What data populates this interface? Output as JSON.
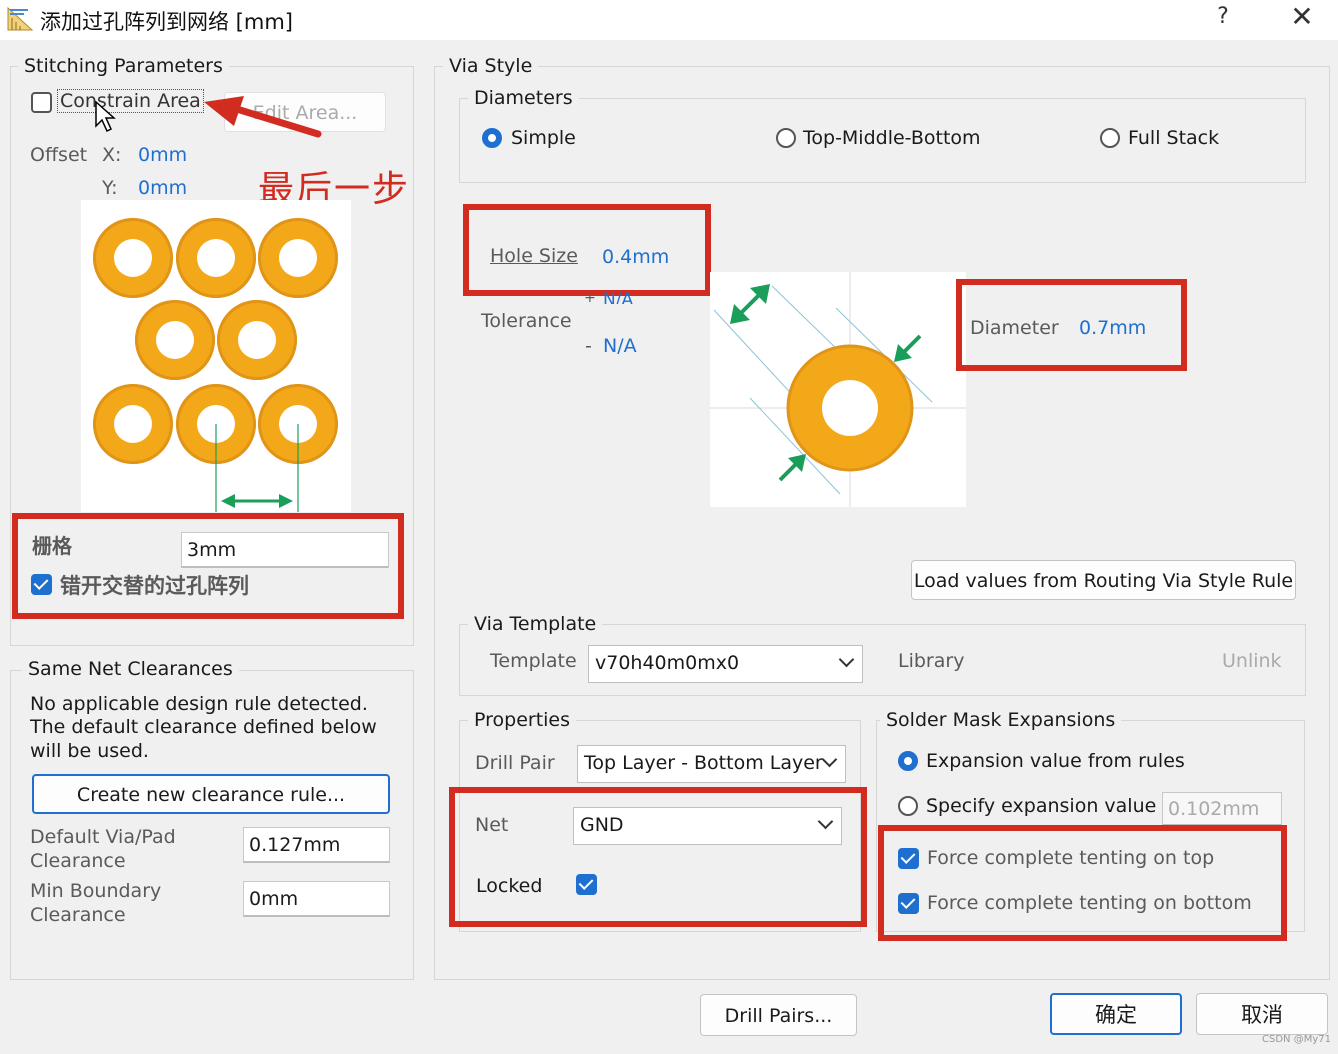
{
  "window": {
    "title": "添加过孔阵列到网络 [mm]",
    "help_label": "?",
    "close_label": "✕"
  },
  "stitching": {
    "legend": "Stitching Parameters",
    "constrain_area_label": "Constrain Area",
    "constrain_area_checked": false,
    "edit_area_label": "Edit Area...",
    "offset_label": "Offset",
    "x_label": "X:",
    "x_value": "0mm",
    "y_label": "Y:",
    "y_value": "0mm",
    "annotation": "最后一步",
    "grid_label": "栅格",
    "grid_value": "3mm",
    "stagger_label": "错开交替的过孔阵列",
    "stagger_checked": true
  },
  "clearances": {
    "legend": "Same Net Clearances",
    "message_line1": "No applicable design rule detected.",
    "message_line2": "The default clearance defined below",
    "message_line3": "will be used.",
    "create_rule_label": "Create new clearance rule...",
    "default_label_1": "Default Via/Pad",
    "default_label_2": "Clearance",
    "default_value": "0.127mm",
    "min_boundary_label_1": "Min Boundary",
    "min_boundary_label_2": "Clearance",
    "min_boundary_value": "0mm"
  },
  "via_style": {
    "legend": "Via Style",
    "diameters_legend": "Diameters",
    "radio_simple": "Simple",
    "radio_tmb": "Top-Middle-Bottom",
    "radio_full": "Full Stack",
    "selected": "Simple",
    "hole_size_label": "Hole Size",
    "hole_size_value": "0.4mm",
    "tolerance_label": "Tolerance",
    "tol_plus_sign": "+",
    "tol_plus_value": "N/A",
    "tol_minus_sign": "-",
    "tol_minus_value": "N/A",
    "diameter_label": "Diameter",
    "diameter_value": "0.7mm",
    "load_rule_label": "Load values from Routing Via Style Rule"
  },
  "via_template": {
    "legend": "Via Template",
    "template_label": "Template",
    "template_value": "v70h40m0mx0",
    "library_label": "Library",
    "unlink_label": "Unlink"
  },
  "properties": {
    "legend": "Properties",
    "drill_pair_label": "Drill Pair",
    "drill_pair_value": "Top Layer - Bottom Layer",
    "net_label": "Net",
    "net_value": "GND",
    "locked_label": "Locked",
    "locked_checked": true
  },
  "solder_mask": {
    "legend": "Solder Mask Expansions",
    "radio_rules": "Expansion value from rules",
    "radio_specify": "Specify expansion value",
    "specify_value": "0.102mm",
    "selected": "Expansion value from rules",
    "tent_top_label": "Force complete tenting on top",
    "tent_top_checked": true,
    "tent_bottom_label": "Force complete tenting on bottom",
    "tent_bottom_checked": true
  },
  "footer": {
    "drill_pairs_label": "Drill Pairs...",
    "ok_label": "确定",
    "cancel_label": "取消",
    "watermark": "CSDN @My71"
  },
  "colors": {
    "accent": "#1f6fd1",
    "highlight_red": "#d22c21",
    "via_copper": "#f3a81a",
    "arrow_green": "#1a9e5a"
  }
}
